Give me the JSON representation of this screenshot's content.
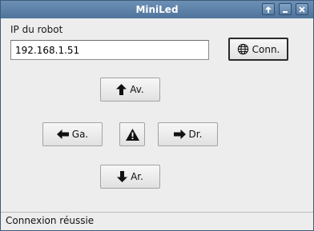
{
  "window": {
    "title": "MiniLed"
  },
  "connection": {
    "ip_label": "IP du robot",
    "ip_value": "192.168.1.51",
    "connect_label": "Conn.",
    "connect_icon": "globe-icon"
  },
  "controls": {
    "forward_label": "Av.",
    "left_label": "Ga.",
    "stop_icon": "warning-icon",
    "right_label": "Dr.",
    "backward_label": "Ar."
  },
  "status": {
    "text": "Connexion réussie"
  }
}
